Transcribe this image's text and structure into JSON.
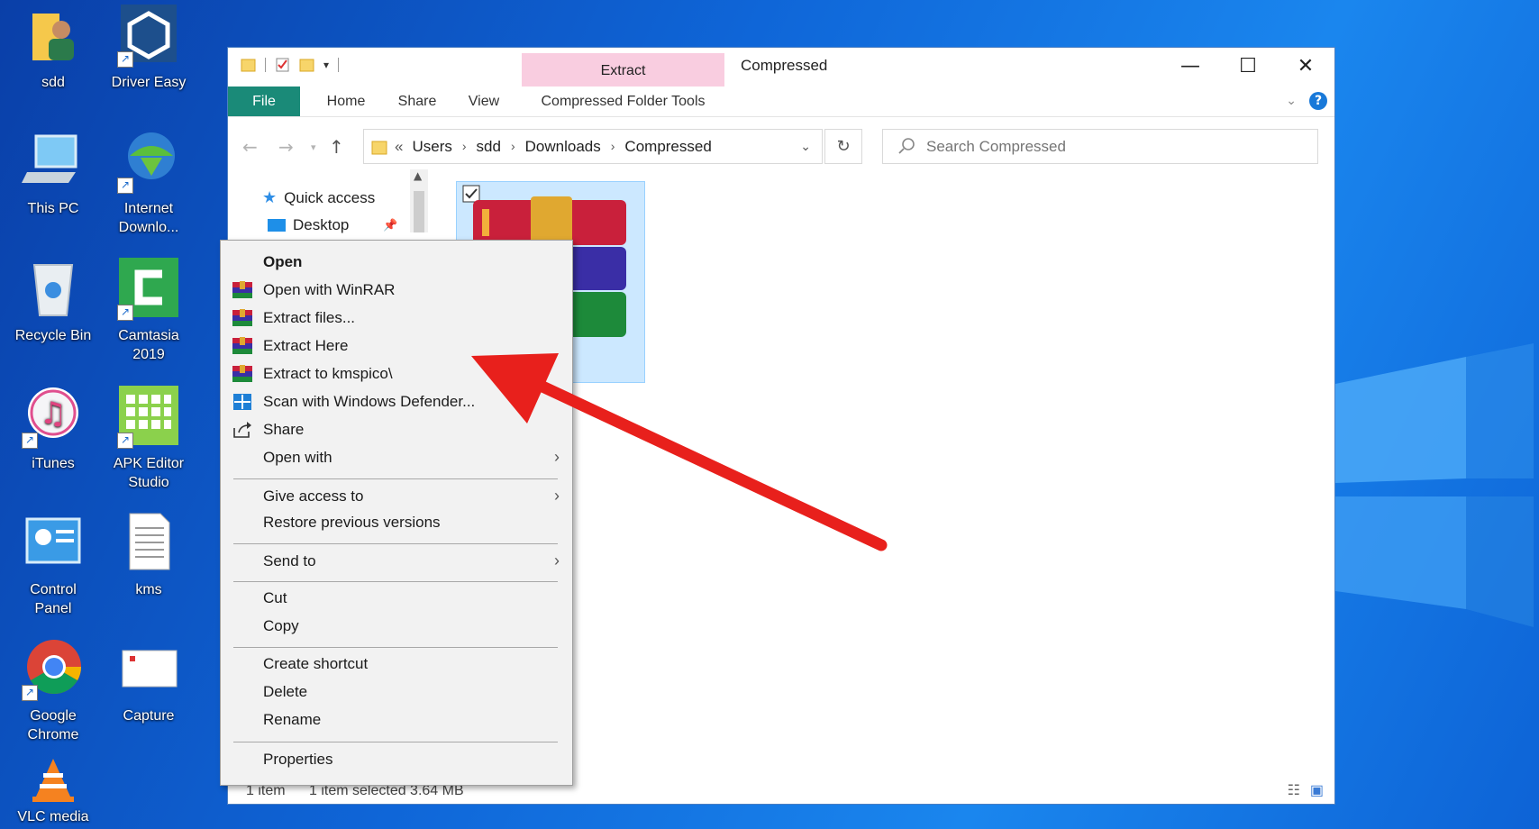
{
  "desktop": {
    "icons": [
      {
        "label": "sdd",
        "icon": "user-folder-icon"
      },
      {
        "label": "Driver Easy",
        "icon": "driver-easy-icon"
      },
      {
        "label": "This PC",
        "icon": "computer-icon"
      },
      {
        "label": "Internet Downlo...",
        "icon": "internet-download-manager-icon"
      },
      {
        "label": "Recycle Bin",
        "icon": "recycle-bin-icon"
      },
      {
        "label": "Camtasia 2019",
        "icon": "camtasia-icon"
      },
      {
        "label": "iTunes",
        "icon": "itunes-icon"
      },
      {
        "label": "APK Editor Studio",
        "icon": "apk-editor-icon"
      },
      {
        "label": "Control Panel",
        "icon": "control-panel-icon"
      },
      {
        "label": "kms",
        "icon": "text-file-icon"
      },
      {
        "label": "Google Chrome",
        "icon": "chrome-icon"
      },
      {
        "label": "Capture",
        "icon": "capture-icon"
      },
      {
        "label": "VLC media",
        "icon": "vlc-icon"
      }
    ]
  },
  "explorer": {
    "title": "Compressed",
    "context_tab_header": "Extract",
    "ribbon_tabs": [
      "File",
      "Home",
      "Share",
      "View",
      "Compressed Folder Tools"
    ],
    "breadcrumb": [
      "Users",
      "sdd",
      "Downloads",
      "Compressed"
    ],
    "breadcrumb_prefix": "«",
    "search_placeholder": "Search Compressed",
    "nav": {
      "quick_access": "Quick access",
      "desktop": "Desktop"
    },
    "status": {
      "count": "1 item",
      "selection": "1 item selected  3.64 MB"
    }
  },
  "context_menu": {
    "items": [
      {
        "label": "Open",
        "bold": true,
        "icon": ""
      },
      {
        "label": "Open with WinRAR",
        "icon": "winrar-icon"
      },
      {
        "label": "Extract files...",
        "icon": "winrar-icon"
      },
      {
        "label": "Extract Here",
        "icon": "winrar-icon"
      },
      {
        "label": "Extract to kmspico\\",
        "icon": "winrar-icon"
      },
      {
        "label": "Scan with Windows Defender...",
        "icon": "defender-icon"
      },
      {
        "label": "Share",
        "icon": "share-icon"
      },
      {
        "label": "Open with",
        "submenu": true
      },
      {
        "label": "Give access to",
        "submenu": true
      },
      {
        "label": "Restore previous versions"
      },
      {
        "label": "Send to",
        "submenu": true
      },
      {
        "label": "Cut"
      },
      {
        "label": "Copy"
      },
      {
        "label": "Create shortcut"
      },
      {
        "label": "Delete"
      },
      {
        "label": "Rename"
      },
      {
        "label": "Properties"
      }
    ]
  },
  "colors": {
    "ribbon_file_tab": "#1a8a78",
    "context_tab": "#f9cde0",
    "selection": "#cce8ff",
    "annotation_arrow": "#e8201c"
  }
}
